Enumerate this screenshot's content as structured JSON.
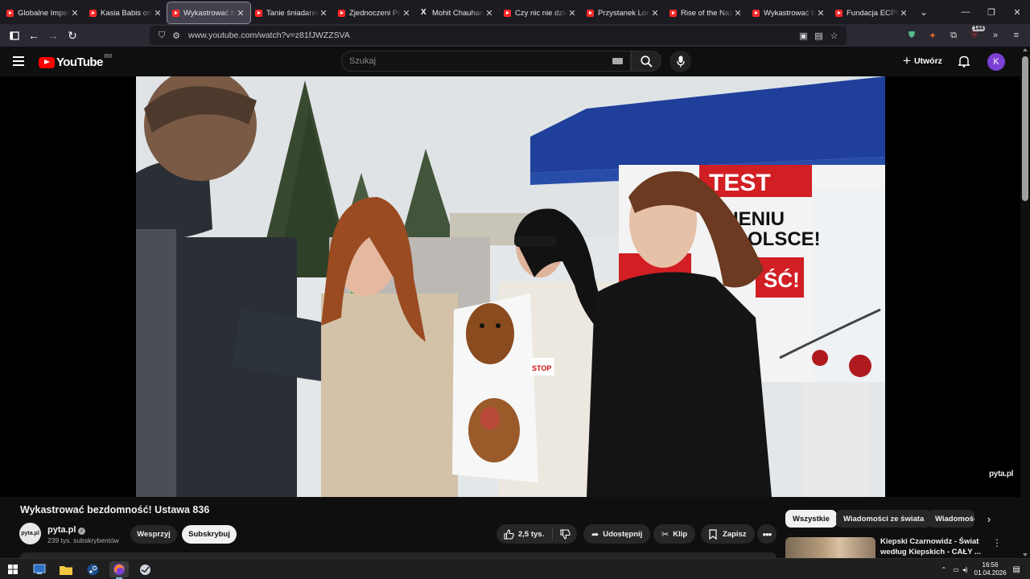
{
  "browser": {
    "tabs": [
      {
        "title": "Globalne Imperium",
        "favicon": "youtube-icon",
        "active": false
      },
      {
        "title": "Kasia Babis omawia",
        "favicon": "youtube-icon",
        "active": false
      },
      {
        "title": "Wykastrować bezdomność",
        "favicon": "youtube-icon",
        "active": true
      },
      {
        "title": "Tanie śniadanie w",
        "favicon": "youtube-icon",
        "active": false
      },
      {
        "title": "Zjednoczeni Przeciw",
        "favicon": "youtube-icon",
        "active": false
      },
      {
        "title": "Mohit Chauhan on",
        "favicon": "x-icon",
        "active": false
      },
      {
        "title": "Czy nic nie dzieje się",
        "favicon": "youtube-icon",
        "active": false
      },
      {
        "title": "Przystanek Lombard",
        "favicon": "youtube-icon",
        "active": false
      },
      {
        "title": "Rise of the Nazis and",
        "favicon": "youtube-icon",
        "active": false
      },
      {
        "title": "Wykastrować bezdomność",
        "favicon": "youtube-icon",
        "active": false
      },
      {
        "title": "Fundacja ECPU Pomoc",
        "favicon": "youtube-icon",
        "active": false
      }
    ],
    "url": "www.youtube.com/watch?v=z81fJWZZSVA",
    "extension_badge": "144"
  },
  "youtube": {
    "logo_text": "YouTube",
    "region": "BR",
    "search_placeholder": "Szukaj",
    "create_label": "Utwórz",
    "account_initial": "K"
  },
  "video": {
    "title": "Wykastrować bezdomność! Ustawa 836",
    "watermark": "pyta.pl",
    "banner_text": [
      "TEST",
      "IENIU",
      "OLSCE!",
      "ŚĆ!"
    ],
    "poster_sign": "STOP"
  },
  "channel": {
    "name": "pyta.pl",
    "subscribers": "239 tys. subskrybentów",
    "avatar_text": "pyta.pl",
    "support_label": "Wesprzyj",
    "subscribe_label": "Subskrybuj"
  },
  "actions": {
    "likes": "2,5 tys.",
    "share": "Udostępnij",
    "clip": "Klip",
    "save": "Zapisz"
  },
  "chips": [
    "Wszystkie",
    "Wiadomości ze świata",
    "Wiadomości"
  ],
  "recommendation": {
    "title": "Kiepski Czarnowidz - Świat według Kiepskich - CAŁY ..."
  },
  "taskbar": {
    "time": "16:56",
    "date": "01.04.2026"
  },
  "colors": {
    "brand_red": "#ff0000",
    "avatar_purple": "#7b3fd3",
    "background": "#0f0f0f"
  }
}
